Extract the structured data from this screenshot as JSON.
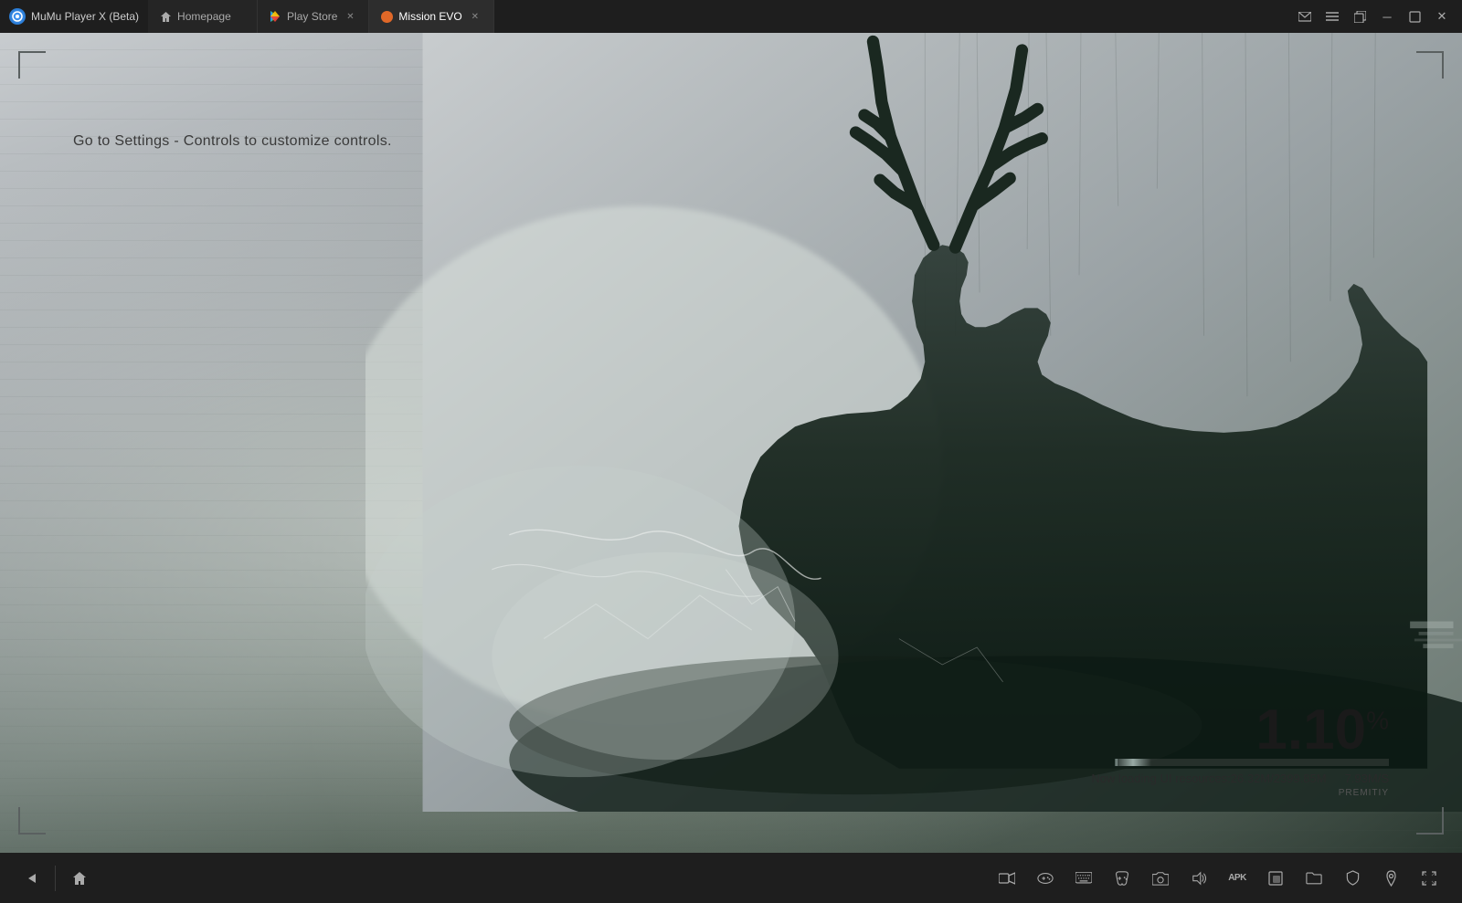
{
  "titlebar": {
    "app_name": "MuMu Player X  (Beta)",
    "app_icon_char": "M"
  },
  "tabs": [
    {
      "id": "homepage",
      "label": "Homepage",
      "icon": "home-icon",
      "active": false,
      "closable": false
    },
    {
      "id": "playstore",
      "label": "Play Store",
      "icon": "playstore-icon",
      "active": false,
      "closable": true
    },
    {
      "id": "missionevo",
      "label": "Mission EVO",
      "icon": "missionevo-icon",
      "active": true,
      "closable": true
    }
  ],
  "win_controls": [
    "mail-icon",
    "menu-icon",
    "restore-icon",
    "minimize-icon",
    "maximize-icon",
    "close-icon"
  ],
  "game": {
    "settings_hint": "Go to Settings - Controls to customize controls.",
    "loading": {
      "percent": "1.10",
      "percent_symbol": "%",
      "bar_fill_pct": 1.1,
      "detail_left": "Now loading UI resources:26.32M/2399.85M",
      "detail_right": "7.93M/S",
      "watermark": "PREMITIY"
    }
  },
  "taskbar": {
    "nav": {
      "back_label": "◁",
      "home_label": "⌂"
    },
    "tools": [
      {
        "id": "camera",
        "icon": "📹",
        "label": "camera-btn"
      },
      {
        "id": "gamepad",
        "icon": "🎮",
        "label": "gamepad-btn"
      },
      {
        "id": "keyboard",
        "icon": "⌨",
        "label": "keyboard-btn"
      },
      {
        "id": "controller2",
        "icon": "🕹",
        "label": "controller2-btn"
      },
      {
        "id": "screenshot",
        "icon": "⬛",
        "label": "screenshot-btn"
      },
      {
        "id": "volume",
        "icon": "🔊",
        "label": "volume-btn"
      },
      {
        "id": "apk",
        "icon": "APK",
        "label": "apk-btn"
      },
      {
        "id": "resize",
        "icon": "⊡",
        "label": "resize-btn"
      },
      {
        "id": "folder",
        "icon": "📁",
        "label": "folder-btn"
      },
      {
        "id": "shield",
        "icon": "🛡",
        "label": "shield-btn"
      },
      {
        "id": "location",
        "icon": "📍",
        "label": "location-btn"
      },
      {
        "id": "expand",
        "icon": "⇄",
        "label": "expand-btn"
      }
    ]
  }
}
